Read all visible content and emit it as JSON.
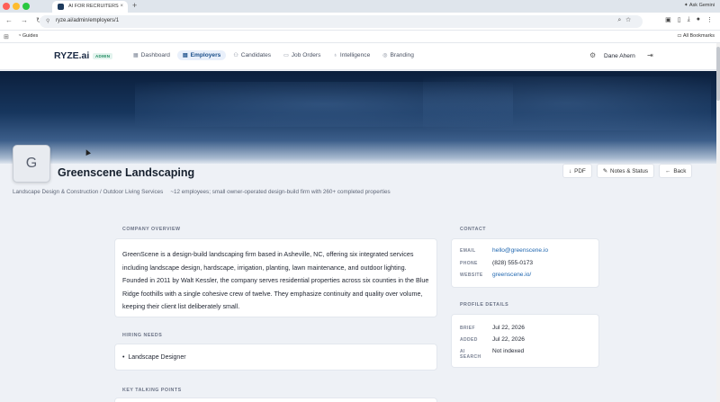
{
  "browser": {
    "tab_title": "AI FOR RECRUITERS",
    "tab_close": "×",
    "new_tab": "+",
    "gemini_label": "Ask Gemini",
    "url": "ryze.ai/admin/employers/1",
    "bookmark_guides": "Guides",
    "bookmark_all": "All Bookmarks"
  },
  "app": {
    "logo": "RYZE.ai",
    "admin_badge": "ADMIN",
    "nav": [
      {
        "label": "Dashboard",
        "icon": "dashboard-icon"
      },
      {
        "label": "Employers",
        "icon": "building-icon",
        "active": true
      },
      {
        "label": "Candidates",
        "icon": "people-icon"
      },
      {
        "label": "Job Orders",
        "icon": "briefcase-icon"
      },
      {
        "label": "Intelligence",
        "icon": "bulb-icon"
      },
      {
        "label": "Branding",
        "icon": "palette-icon"
      }
    ],
    "user_name": "Dane Ahern"
  },
  "employer": {
    "initial": "G",
    "name": "Greenscene Landscaping",
    "industry": "Landscape Design & Construction / Outdoor Living Services",
    "size": "~12 employees; small owner-operated design-build firm with 260+ completed properties",
    "actions": {
      "pdf": "PDF",
      "notes": "Notes & Status",
      "back": "Back"
    }
  },
  "overview": {
    "label": "COMPANY OVERVIEW",
    "text": "GreenScene is a design-build landscaping firm based in Asheville, NC, offering six integrated services including landscape design, hardscape, irrigation, planting, lawn maintenance, and outdoor lighting. Founded in 2011 by Walt Kessler, the company serves residential properties across six counties in the Blue Ridge foothills with a single cohesive crew of twelve. They emphasize continuity and quality over volume, keeping their client list deliberately small."
  },
  "hiring": {
    "label": "HIRING NEEDS",
    "items": [
      "Landscape Designer"
    ]
  },
  "talking_points": {
    "label": "KEY TALKING POINTS"
  },
  "contact": {
    "label": "CONTACT",
    "email_key": "EMAIL",
    "email": "hello@greenscene.io",
    "phone_key": "PHONE",
    "phone": "(828) 555-0173",
    "website_key": "WEBSITE",
    "website": "greenscene.io/"
  },
  "profile": {
    "label": "PROFILE DETAILS",
    "brief_key": "BRIEF",
    "brief": "Jul 22, 2026",
    "added_key": "ADDED",
    "added": "Jul 22, 2026",
    "ai_search_key": "AI SEARCH",
    "ai_search": "Not indexed"
  }
}
